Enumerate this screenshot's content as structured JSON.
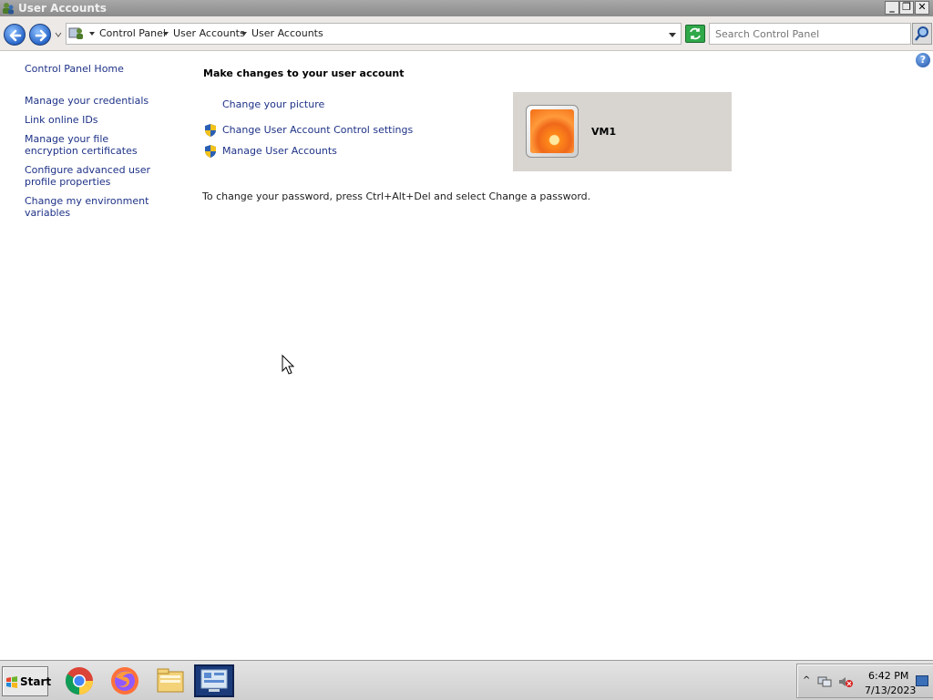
{
  "window": {
    "title": "User Accounts",
    "minimize": "_",
    "maximize": "❐",
    "close": "✕"
  },
  "address": {
    "crumbs": [
      "Control Panel",
      "User Accounts",
      "User Accounts"
    ],
    "search_placeholder": "Search Control Panel"
  },
  "sidebar": {
    "home": "Control Panel Home",
    "links": [
      "Manage your credentials",
      "Link online IDs",
      "Manage your file encryption certificates",
      "Configure advanced user profile properties",
      "Change my environment variables"
    ]
  },
  "main": {
    "heading": "Make changes to your user account",
    "tasks": [
      {
        "label": "Change your picture",
        "icon": "none"
      },
      {
        "label": "Change User Account Control settings",
        "icon": "uac-shield-icon"
      },
      {
        "label": "Manage User Accounts",
        "icon": "uac-shield-icon"
      }
    ],
    "note": "To change your password, press Ctrl+Alt+Del and select Change a password.",
    "account_name": "VM1"
  },
  "taskbar": {
    "start_label": "Start",
    "apps": [
      "chrome-icon",
      "firefox-icon",
      "file-explorer-icon",
      "control-panel-icon"
    ],
    "time": "6:42 PM",
    "date": "7/13/2023",
    "tray_expand": "^"
  },
  "colors": {
    "link": "#1e3287",
    "tile_bg": "#d8d5d0",
    "titlebar": "#9a9a9a"
  }
}
